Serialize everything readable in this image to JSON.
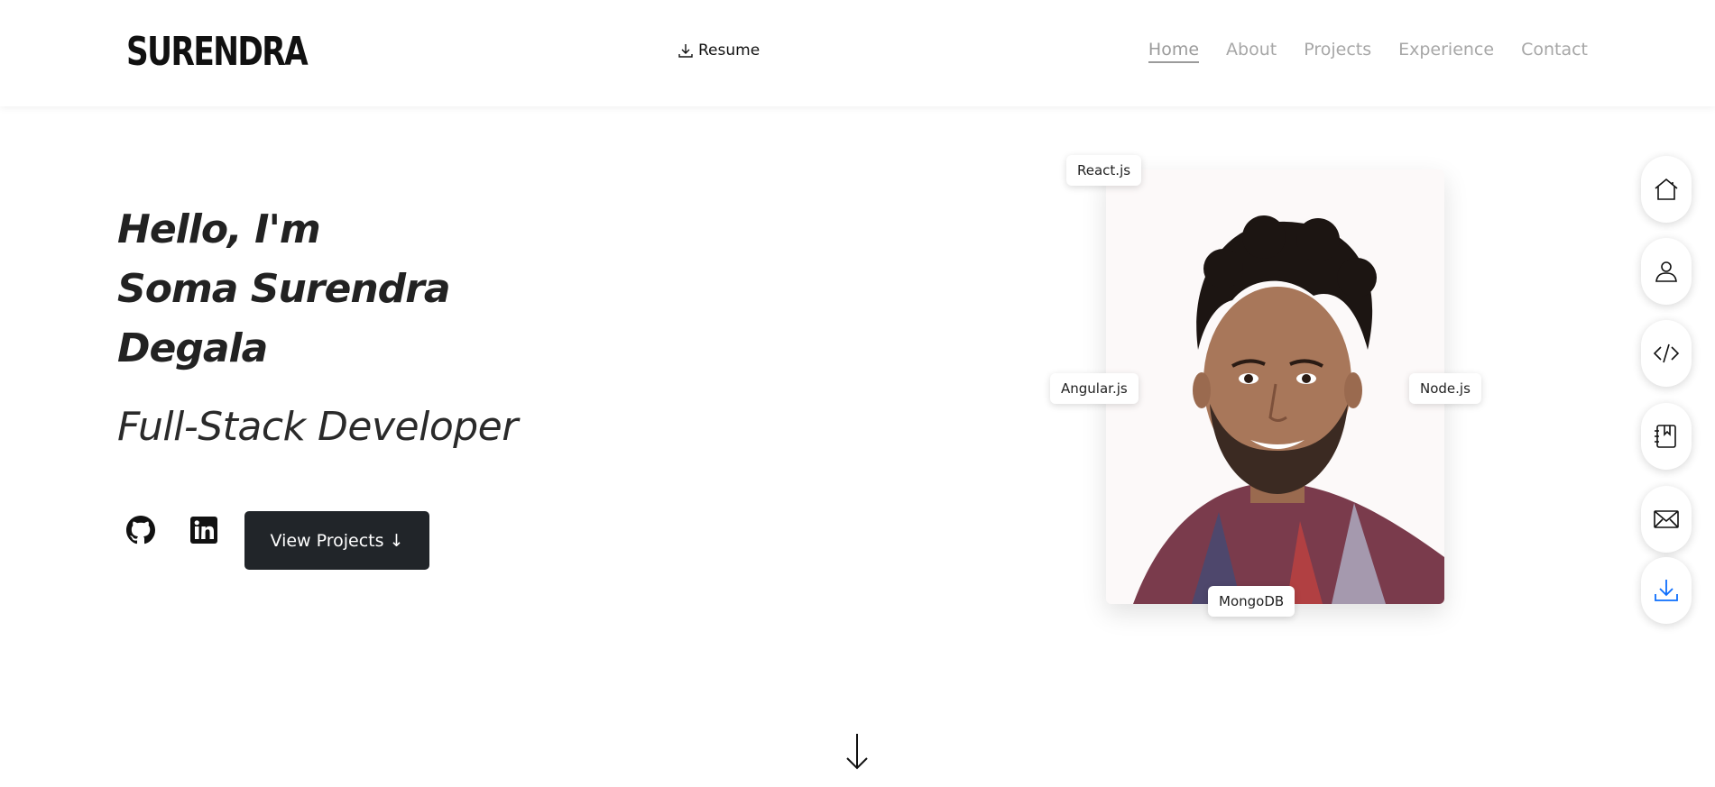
{
  "header": {
    "logo": "SURENDRA",
    "resume_label": "Resume",
    "nav": [
      "Home",
      "About",
      "Projects",
      "Experience",
      "Contact"
    ],
    "active_nav": "Home"
  },
  "hero": {
    "greeting": "Hello, I'm",
    "name_line1": "Soma Surendra",
    "name_line2": "Degala",
    "role": "Full-Stack Developer",
    "view_projects_label": "View Projects ↓"
  },
  "tags": {
    "react": "React.js",
    "angular": "Angular.js",
    "node": "Node.js",
    "mongo": "MongoDB"
  },
  "side_nav": [
    "home-icon",
    "user-icon",
    "code-icon",
    "notebook-icon",
    "mail-icon",
    "download-icon"
  ],
  "colors": {
    "accent": "#0d6efd",
    "button_bg": "#212529",
    "nav_inactive": "#a7a7a7"
  }
}
